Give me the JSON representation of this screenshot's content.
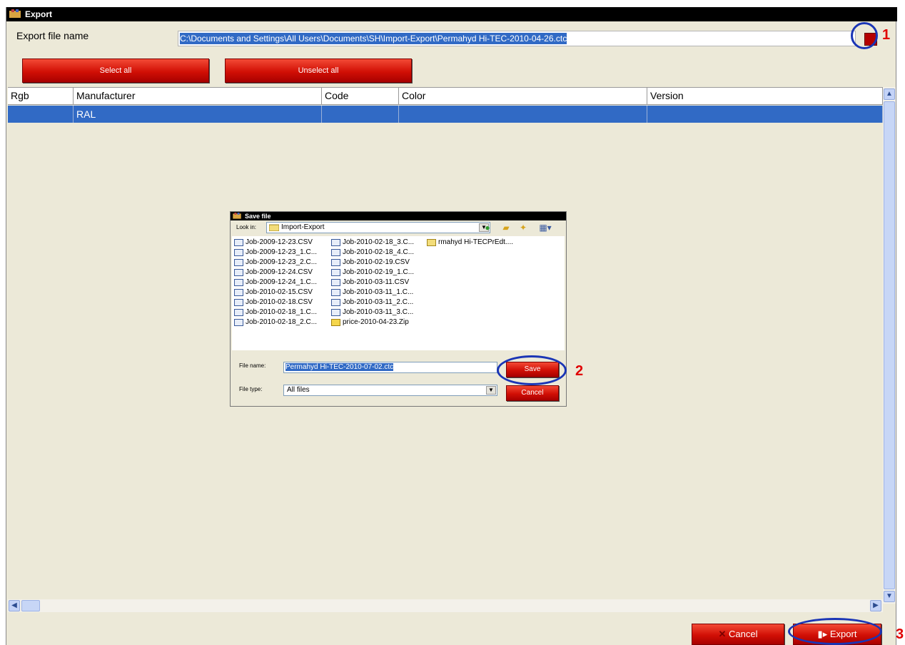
{
  "window": {
    "title": "Export"
  },
  "export_file": {
    "label": "Export file name",
    "value": "C:\\Documents and Settings\\All Users\\Documents\\SH\\Import-Export\\Permahyd Hi-TEC-2010-04-26.ctc"
  },
  "buttons": {
    "select_all": "Select all",
    "unselect_all": "Unselect all",
    "cancel": "Cancel",
    "export": "Export"
  },
  "table": {
    "columns": [
      "Rgb",
      "Manufacturer",
      "Code",
      "Color",
      "Version"
    ],
    "rows": [
      {
        "rgb": "",
        "manufacturer": "RAL",
        "code": "",
        "color": "",
        "version": ""
      }
    ]
  },
  "save_dialog": {
    "title": "Save file",
    "look_in_label": "Look in:",
    "look_in_value": "Import-Export",
    "files_col1": [
      "Job-2009-12-23.CSV",
      "Job-2009-12-23_1.C...",
      "Job-2009-12-23_2.C...",
      "Job-2009-12-24.CSV",
      "Job-2009-12-24_1.C...",
      "Job-2010-02-15.CSV",
      "Job-2010-02-18.CSV",
      "Job-2010-02-18_1.C...",
      "Job-2010-02-18_2.C..."
    ],
    "files_col2": [
      "Job-2010-02-18_3.C...",
      "Job-2010-02-18_4.C...",
      "Job-2010-02-19.CSV",
      "Job-2010-02-19_1.C...",
      "Job-2010-03-11.CSV",
      "Job-2010-03-11_1.C...",
      "Job-2010-03-11_2.C...",
      "Job-2010-03-11_3.C...",
      "price-2010-04-23.Zip"
    ],
    "files_col3": [
      "rmahyd Hi-TECPrEdt...."
    ],
    "file_name_label": "File name:",
    "file_name_value": "Permahyd Hi-TEC-2010-07-02.ctc",
    "file_type_label": "File type:",
    "file_type_value": "All files",
    "save": "Save",
    "cancel": "Cancel"
  },
  "callouts": [
    "1",
    "2",
    "3"
  ],
  "colors": {
    "accent_red": "#d10f05",
    "selection_blue": "#316ac5",
    "callout_blue": "#1a35b5",
    "callout_number": "#e00000"
  }
}
